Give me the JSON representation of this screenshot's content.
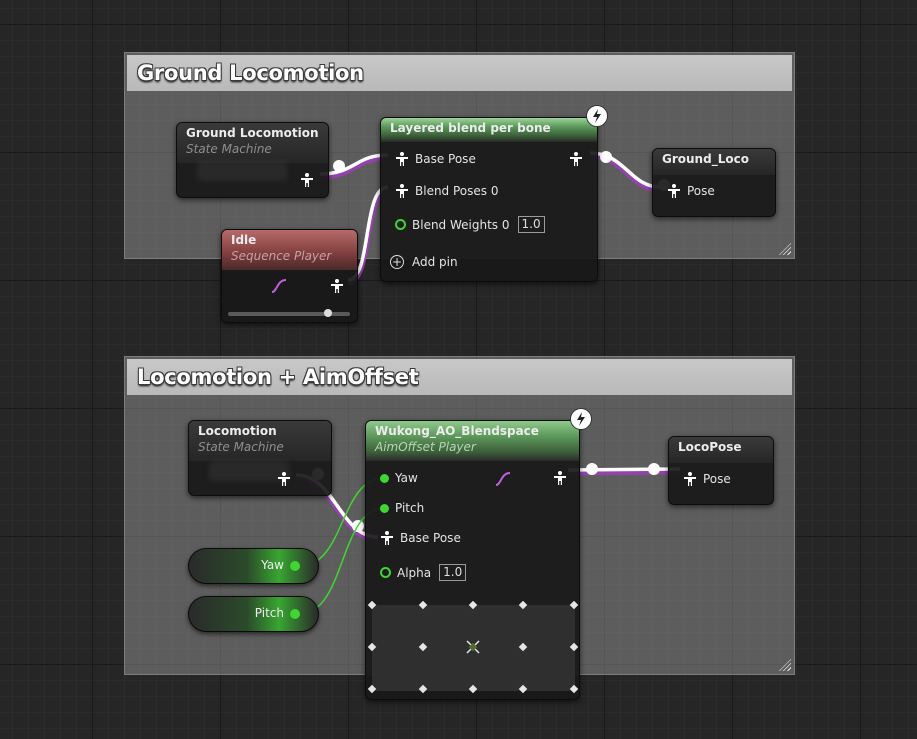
{
  "comments": {
    "top": {
      "title": "Ground Locomotion"
    },
    "bottom": {
      "title": "Locomotion + AimOffset"
    }
  },
  "nodes": {
    "ground_sm": {
      "title": "Ground Locomotion",
      "subtitle": "State Machine"
    },
    "idle": {
      "title": "Idle",
      "subtitle": "Sequence Player"
    },
    "layered_blend": {
      "title": "Layered blend per bone",
      "pins": {
        "base_pose": "Base Pose",
        "blend_poses": "Blend Poses 0",
        "blend_weights": "Blend Weights 0",
        "blend_weights_value": "1.0",
        "add_pin": "Add pin"
      }
    },
    "ground_loco": {
      "title": "Ground_Loco",
      "pin": "Pose"
    },
    "locomotion_sm": {
      "title": "Locomotion",
      "subtitle": "State Machine"
    },
    "aim_offset": {
      "title": "Wukong_AO_Blendspace",
      "subtitle": "AimOffset Player",
      "pins": {
        "yaw": "Yaw",
        "pitch": "Pitch",
        "base_pose": "Base Pose",
        "alpha": "Alpha",
        "alpha_value": "1.0"
      }
    },
    "loco_pose": {
      "title": "LocoPose",
      "pin": "Pose"
    },
    "yaw_var": {
      "label": "Yaw"
    },
    "pitch_var": {
      "label": "Pitch"
    }
  },
  "colors": {
    "pose_wire": "#ffffff",
    "pose_wire_shadow": "#9b3fb8",
    "float_wire": "#3fd631",
    "green_header": "#5e9a5c",
    "red_header": "#7e3d3d"
  },
  "icons": [
    "pose-person-icon",
    "float-pin-icon",
    "lightning-icon",
    "add-pin-icon",
    "sequence-curve-icon",
    "resize-grip-icon"
  ]
}
